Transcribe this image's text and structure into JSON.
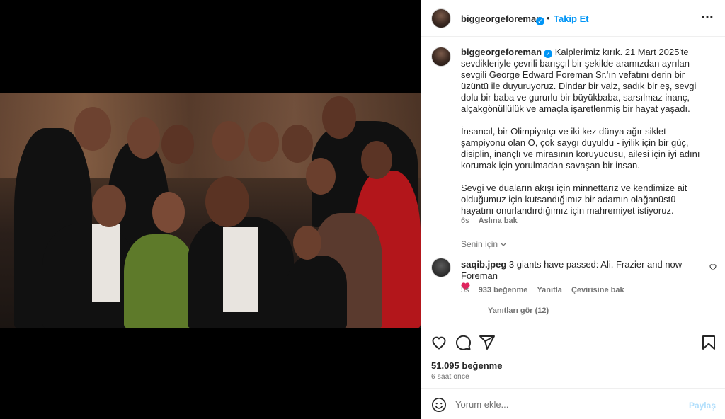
{
  "post": {
    "username": "biggeorgeforeman",
    "follow_label": "Takip Et",
    "dot": "•",
    "more_label": "•••",
    "verified_mark": "✓"
  },
  "caption": {
    "username": "biggeorgeforeman",
    "paragraph_1": "Kalplerimiz kırık. 21 Mart 2025'te sevdikleriyle çevrili barışçıl bir şekilde aramızdan ayrılan sevgili George Edward Foreman Sr.'ın vefatını derin bir üzüntü ile duyuruyoruz. Dindar bir vaiz, sadık bir eş, sevgi dolu bir baba ve gururlu bir büyükbaba, sarsılmaz inanç, alçakgönüllülük ve amaçla işaretlenmiş bir hayat yaşadı.",
    "paragraph_2": "İnsancıl, bir Olimpiyatçı ve iki kez dünya ağır siklet şampiyonu olan O, çok saygı duyuldu - iyilik için bir güç, disiplin, inançlı ve mirasının koruyucusu, ailesi için iyi adını korumak için yorulmadan savaşan bir insan.",
    "paragraph_3": "Sevgi ve duaların akışı için minnettarız ve kendimize ait olduğumuz için kutsandığımız bir adamın olağanüstü hayatını onurlandırdığımız için mahremiyet istiyoruz.",
    "time": "6s",
    "see_translation": "Aslına bak"
  },
  "audience": {
    "label": "Senin için",
    "chevron": "⌄"
  },
  "comment": {
    "username": "saqib.jpeg",
    "text": "3 giants have passed: Ali, Frazier and now Foreman",
    "time": "5s",
    "likes": "933 beğenme",
    "reply": "Yanıtla",
    "translate": "Çevirisine bak"
  },
  "replies": {
    "label": "Yanıtları gör (12)"
  },
  "actions": {
    "likes_count": "51.095 beğenme",
    "time_ago": "6 saat önce"
  },
  "composer": {
    "placeholder": "Yorum ekle...",
    "post_label": "Paylaş"
  },
  "colors": {
    "accent": "#0095f6",
    "text": "#262626",
    "muted": "#737373",
    "heart": "#e0245e"
  },
  "icons": [
    "verified-icon",
    "more-icon",
    "heart-icon",
    "comment-icon",
    "share-icon",
    "save-icon",
    "emoji-icon",
    "chevron-down-icon"
  ]
}
